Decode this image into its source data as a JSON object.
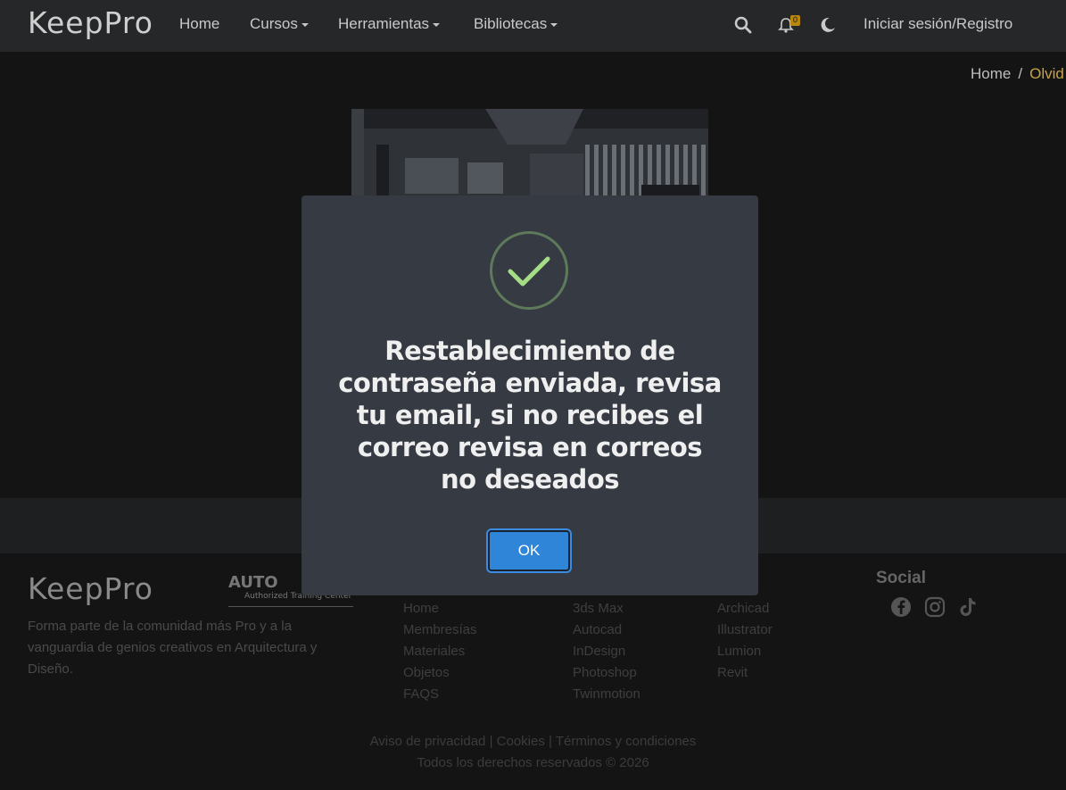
{
  "navbar": {
    "logo": "KeepPro",
    "items": [
      {
        "label": "Home"
      },
      {
        "label": "Cursos"
      },
      {
        "label": "Herramientas"
      },
      {
        "label": "Bibliotecas"
      }
    ],
    "icons": [
      "search-icon",
      "bell-icon",
      "moon-icon"
    ],
    "notification_count": "0",
    "login_label": "Iniciar sesión/Registro"
  },
  "breadcrumb": {
    "home": "Home",
    "separator": "/",
    "current": "Olvid"
  },
  "modal": {
    "icon": "success-check-icon",
    "message": "Restablecimiento de contraseña enviada, revisa tu email, si no recibes el correo revisa en correos no deseados",
    "ok_label": "OK"
  },
  "footer": {
    "logo": "KeepPro",
    "autodesk_name": "AUTO",
    "autodesk_sub": "Authorized Training Center",
    "description": "Forma parte de la comunidad más Pro y a la vanguardia de genios creativos en Arquitectura y Diseño.",
    "col1": [
      "Home",
      "Membresías",
      "Materiales",
      "Objetos",
      "FAQS"
    ],
    "col2": [
      "3ds Max",
      "Autocad",
      "InDesign",
      "Photoshop",
      "Twinmotion"
    ],
    "col3": [
      "Archicad",
      "Illustrator",
      "Lumion",
      "Revit"
    ],
    "social_title": "Social",
    "social_icons": [
      "facebook-icon",
      "instagram-icon",
      "tiktok-icon"
    ],
    "legal": {
      "privacy": "Aviso de privacidad",
      "cookies": "Cookies",
      "terms": "Términos y condiciones",
      "sep": "|"
    },
    "rights": "Todos los derechos reservados © 2026"
  },
  "colors": {
    "accent": "#2f85d8",
    "success": "#a5dc86",
    "badge": "#b8860b",
    "breadcrumb_current": "#c8a24a"
  }
}
